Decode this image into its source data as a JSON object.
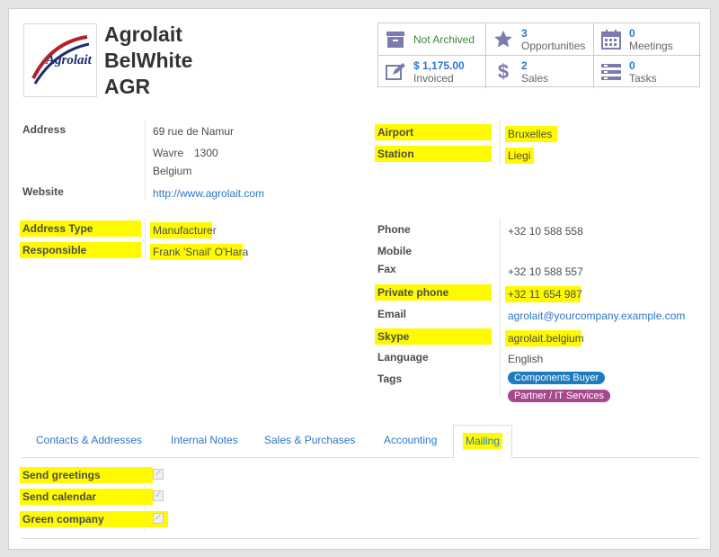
{
  "partner": {
    "logo_text": "Agrolait",
    "name_line1": "Agrolait",
    "name_line2": "BelWhite",
    "name_line3": "AGR"
  },
  "stats": [
    {
      "icon": "archive-icon",
      "num": "",
      "label": "Not Archived"
    },
    {
      "icon": "star-icon",
      "num": "3",
      "label": "Opportunities"
    },
    {
      "icon": "calendar-icon",
      "num": "0",
      "label": "Meetings"
    },
    {
      "icon": "edit-icon",
      "num": "$ 1,175.00",
      "label": "Invoiced"
    },
    {
      "icon": "dollar-icon",
      "num": "2",
      "label": "Sales"
    },
    {
      "icon": "tasks-icon",
      "num": "0",
      "label": "Tasks"
    }
  ],
  "left": {
    "address_label": "Address",
    "street": "69 rue de Namur",
    "city": "Wavre",
    "zip": "1300",
    "country": "Belgium",
    "website_label": "Website",
    "website": "http://www.agrolait.com",
    "address_type_label": "Address Type",
    "address_type": "Manufacturer",
    "responsible_label": "Responsible",
    "responsible": "Frank 'Snail' O'Hara"
  },
  "right": {
    "airport_label": "Airport",
    "airport": "Bruxelles",
    "station_label": "Station",
    "station": "Liegi",
    "phone_label": "Phone",
    "phone": "+32 10 588 558",
    "mobile_label": "Mobile",
    "fax_label": "Fax",
    "fax": "+32 10 588 557",
    "private_phone_label": "Private phone",
    "private_phone": "+32 11 654 987",
    "email_label": "Email",
    "email": "agrolait@yourcompany.example.com",
    "skype_label": "Skype",
    "skype": "agrolait.belgium",
    "language_label": "Language",
    "language": "English",
    "tags_label": "Tags",
    "tag1": "Components Buyer",
    "tag2": "Partner / IT Services",
    "tag1_color": "#1f7bbf",
    "tag2_color": "#a8488c"
  },
  "tabs": {
    "contacts": "Contacts & Addresses",
    "notes": "Internal Notes",
    "sales": "Sales & Purchases",
    "accounting": "Accounting",
    "mailing": "Mailing"
  },
  "mailing": {
    "send_greetings": "Send greetings",
    "send_calendar": "Send calendar",
    "green_company": "Green company"
  },
  "colors": {
    "highlight": "#fffa00",
    "link": "#2e77c7",
    "icon": "#7c7bad"
  }
}
